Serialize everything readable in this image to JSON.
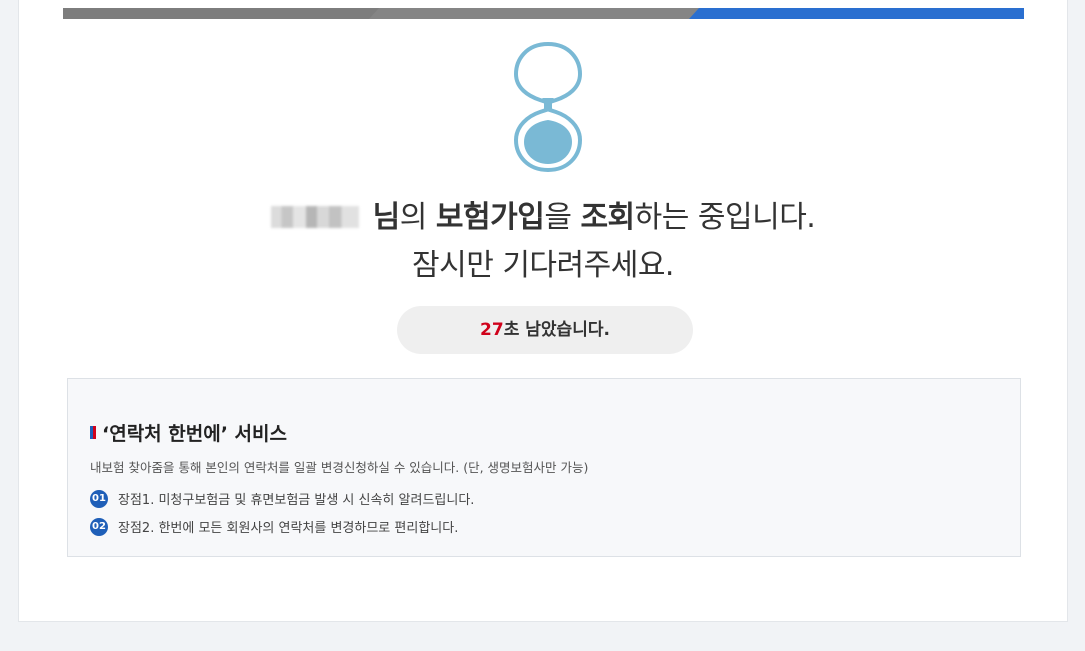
{
  "progress": {
    "steps": 3,
    "current_step": 3,
    "colors": {
      "done": "#808080",
      "active": "#2a6fd0"
    }
  },
  "status": {
    "user_name_masked": "",
    "line1_suffix_1": "님",
    "line1_text_2": "의 ",
    "line1_bold_3": "보험가입",
    "line1_text_4": "을 ",
    "line1_bold_5": "조회",
    "line1_text_6": "하는 중입니다.",
    "line2": "잠시만 기다려주세요."
  },
  "timer": {
    "seconds": "27",
    "suffix": "초 남았습니다."
  },
  "service": {
    "title": "‘연락처 한번에’ 서비스",
    "description": "내보험 찾아줌을 통해 본인의 연락처를 일괄 변경신청하실 수 있습니다. (단, 생명보험사만 가능)",
    "benefits": [
      {
        "num": "01",
        "text": "장점1. 미청구보험금 및 휴면보험금 발생 시 신속히 알려드립니다."
      },
      {
        "num": "02",
        "text": "장점2. 한번에 모든 회원사의 연락처를 변경하므로 편리합니다."
      }
    ]
  },
  "colors": {
    "accent_blue": "#1f5fb8",
    "highlight_red": "#d0021b",
    "hourglass": "#7ab9d5"
  },
  "icons": {
    "loading": "hourglass-icon",
    "title_marker": "flag-icon"
  }
}
